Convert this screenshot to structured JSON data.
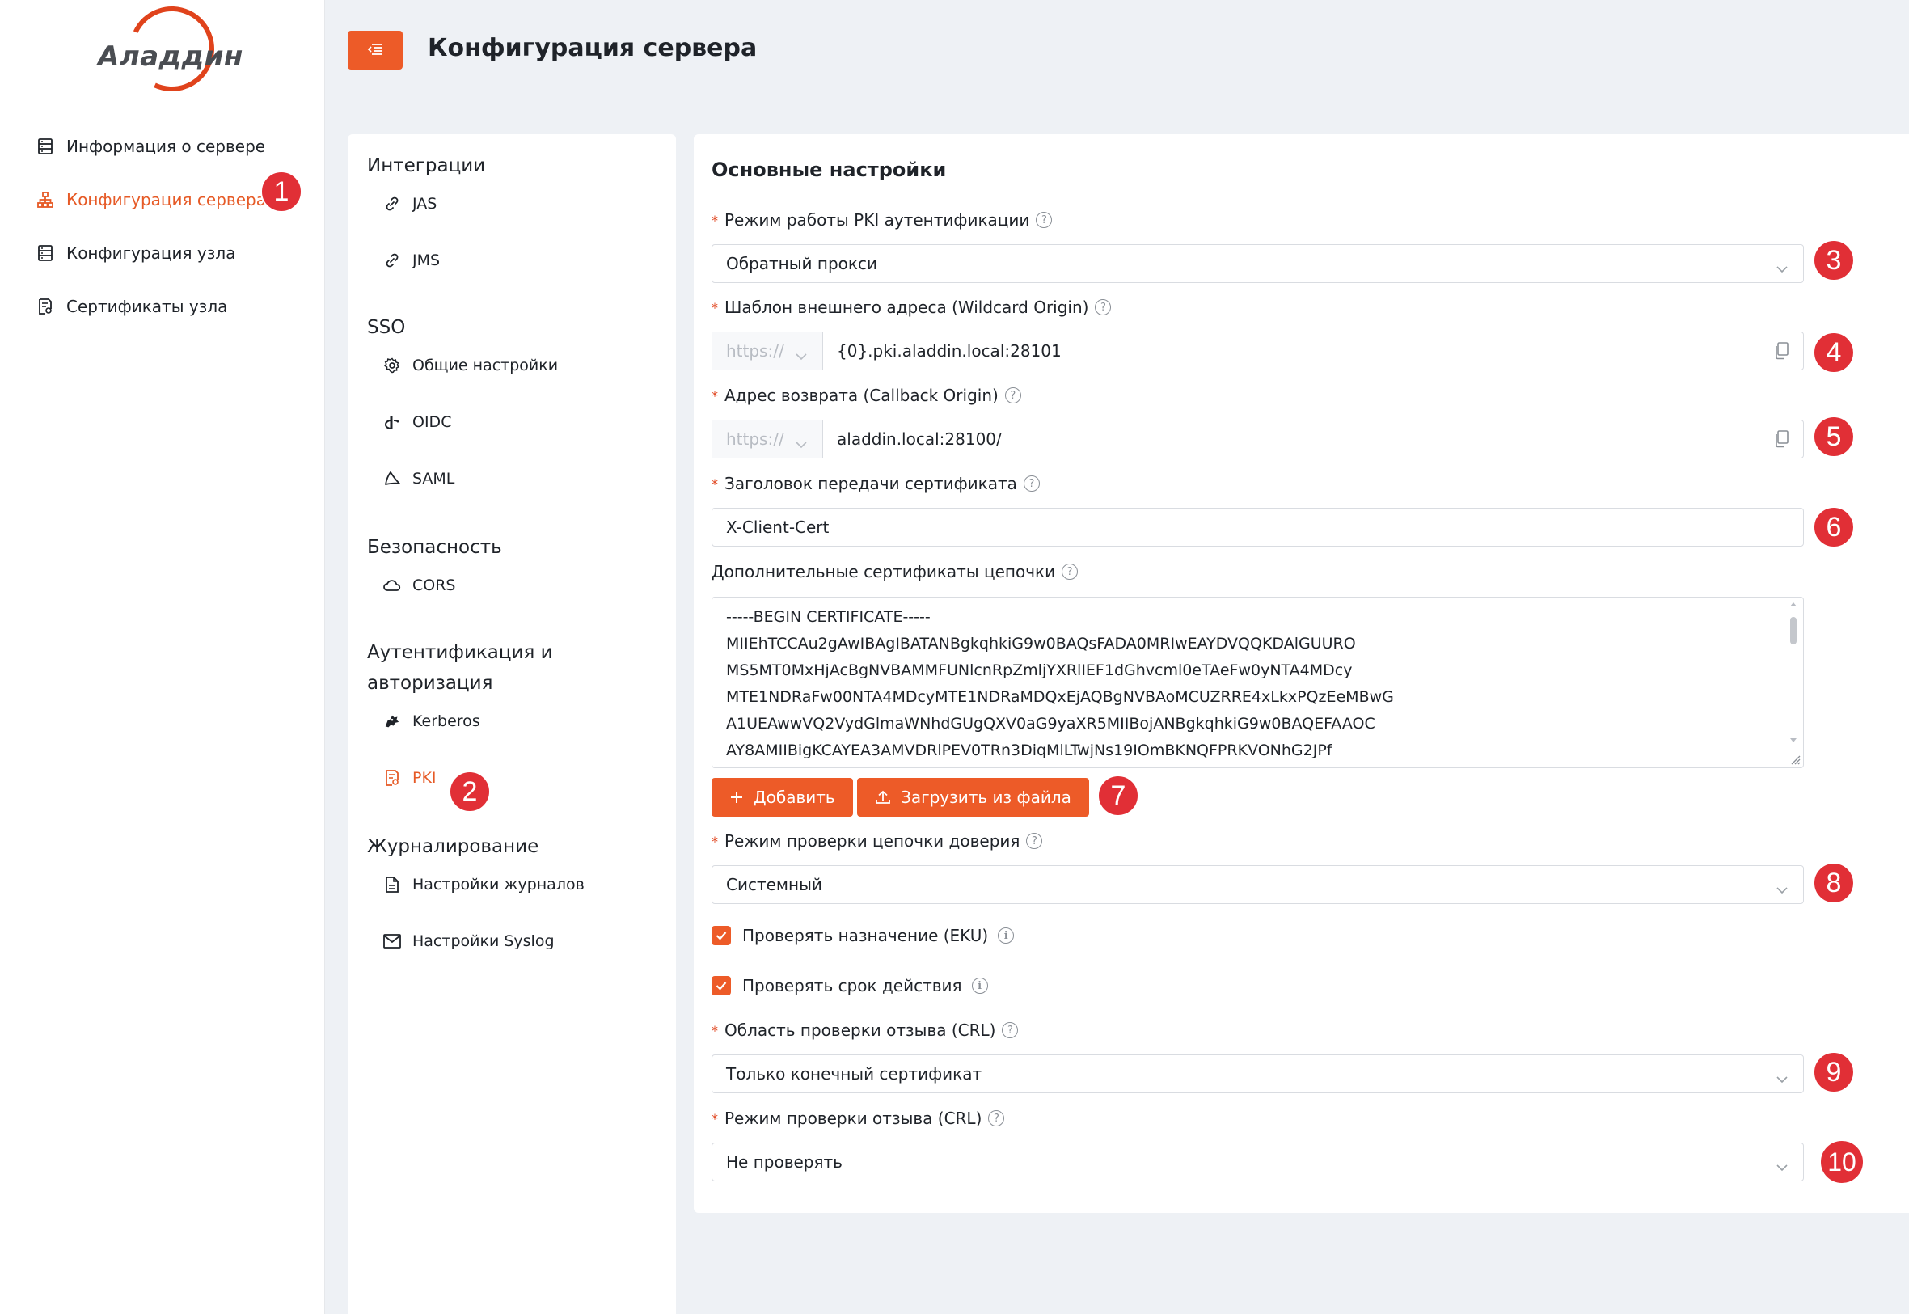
{
  "app": {
    "logo_text": "Аладдин",
    "brand_color": "#ED5B28",
    "badge_color": "#E12F36"
  },
  "sidebar": {
    "items": [
      {
        "label": "Информация о сервере",
        "icon": "server-icon"
      },
      {
        "label": "Конфигурация сервера",
        "icon": "sitemap-icon",
        "active": true
      },
      {
        "label": "Конфигурация узла",
        "icon": "server-icon"
      },
      {
        "label": "Сертификаты узла",
        "icon": "certificate-icon"
      }
    ]
  },
  "header": {
    "title": "Конфигурация сервера",
    "menu_icon": "menu-fold-icon"
  },
  "subnav": {
    "sections": [
      {
        "title": "Интеграции",
        "items": [
          {
            "label": "JAS",
            "icon": "link-icon"
          },
          {
            "label": "JMS",
            "icon": "link-icon"
          }
        ]
      },
      {
        "title": "SSO",
        "items": [
          {
            "label": "Общие настройки",
            "icon": "gear-icon"
          },
          {
            "label": "OIDC",
            "icon": "openid-icon"
          },
          {
            "label": "SAML",
            "icon": "saml-icon"
          }
        ]
      },
      {
        "title": "Безопасность",
        "items": [
          {
            "label": "CORS",
            "icon": "cloud-icon"
          }
        ]
      },
      {
        "title": "Аутентификация и авторизация",
        "title_line1": "Аутентификация и",
        "title_line2": "авторизация",
        "items": [
          {
            "label": "Kerberos",
            "icon": "kerberos-icon"
          },
          {
            "label": "PKI",
            "icon": "certificate-icon",
            "active": true
          }
        ]
      },
      {
        "title": "Журналирование",
        "items": [
          {
            "label": "Настройки журналов",
            "icon": "file-icon"
          },
          {
            "label": "Настройки Syslog",
            "icon": "mail-icon"
          }
        ]
      }
    ]
  },
  "form": {
    "title": "Основные настройки",
    "pki_mode": {
      "label": "Режим работы PKI аутентификации",
      "value": "Обратный прокси"
    },
    "wildcard_origin": {
      "label": "Шаблон внешнего адреса (Wildcard Origin)",
      "scheme": "https://",
      "value": "{0}.pki.aladdin.local:28101"
    },
    "callback_origin": {
      "label": "Адрес возврата (Callback Origin)",
      "scheme": "https://",
      "value": "aladdin.local:28100/"
    },
    "cert_header": {
      "label": "Заголовок передачи сертификата",
      "value": "X-Client-Cert"
    },
    "chain_certs": {
      "label": "Дополнительные сертификаты цепочки",
      "lines": [
        "-----BEGIN CERTIFICATE-----",
        "MIIEhTCCAu2gAwIBAgIBATANBgkqhkiG9w0BAQsFADA0MRIwEAYDVQQKDAlGUURO",
        "MS5MT0MxHjAcBgNVBAMMFUNlcnRpZmljYXRlIEF1dGhvcml0eTAeFw0yNTA4MDcy",
        "MTE1NDRaFw00NTA4MDcyMTE1NDRaMDQxEjAQBgNVBAoMCUZRRE4xLkxPQzEeMBwG",
        "A1UEAwwVQ2VydGlmaWNhdGUgQXV0aG9yaXR5MIIBojANBgkqhkiG9w0BAQEFAAOC",
        "AY8AMIIBigKCAYEA3AMVDRlPEV0TRn3DiqMlLTwjNs19IOmBKNQFPRKVONhG2JPf"
      ]
    },
    "add_button": "Добавить",
    "upload_button": "Загрузить из файла",
    "chain_mode": {
      "label": "Режим проверки цепочки доверия",
      "value": "Системный"
    },
    "check_eku": {
      "label": "Проверять назначение (EKU)",
      "checked": true
    },
    "check_validity": {
      "label": "Проверять срок действия",
      "checked": true
    },
    "crl_scope": {
      "label": "Область проверки отзыва (CRL)",
      "value": "Только конечный сертификат"
    },
    "crl_mode": {
      "label": "Режим проверки отзыва (CRL)",
      "value": "Не проверять"
    }
  },
  "badges": [
    "1",
    "2",
    "3",
    "4",
    "5",
    "6",
    "7",
    "8",
    "9",
    "10"
  ]
}
